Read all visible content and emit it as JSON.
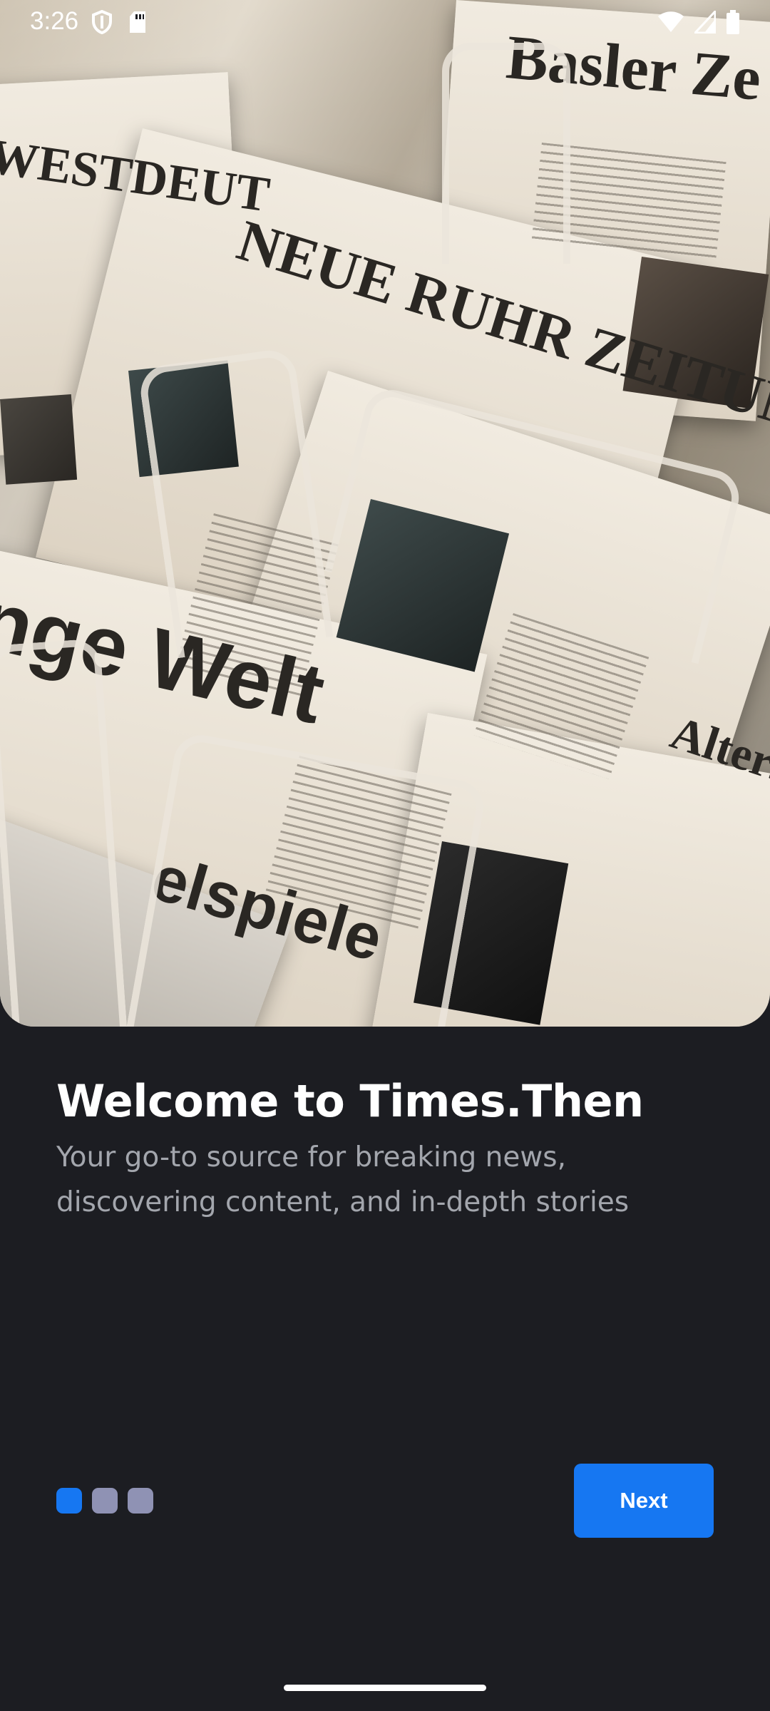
{
  "status_bar": {
    "time": "3:26",
    "left_icons": [
      "shield-icon",
      "sd-card-icon"
    ],
    "right_icons": [
      "wifi-icon",
      "cellular-signal-icon",
      "battery-icon"
    ]
  },
  "hero": {
    "image_subject": "newspapers-on-rack",
    "headlines": [
      "NEUE RUHR ZEITUNG",
      "Basler Ze",
      "WESTDEUT",
      "nge Welt",
      "elspiele",
      "Altersa"
    ]
  },
  "onboarding": {
    "title": "Welcome to Times.Then",
    "subtitle": "Your go-to source for breaking news, discovering content, and in-depth stories",
    "page_indicator": {
      "total": 3,
      "current": 1
    },
    "next_label": "Next"
  },
  "colors": {
    "background": "#1c1d22",
    "accent": "#1677f2",
    "inactive_dot": "#8f92b4",
    "subtitle_text": "#a3a6ad"
  }
}
